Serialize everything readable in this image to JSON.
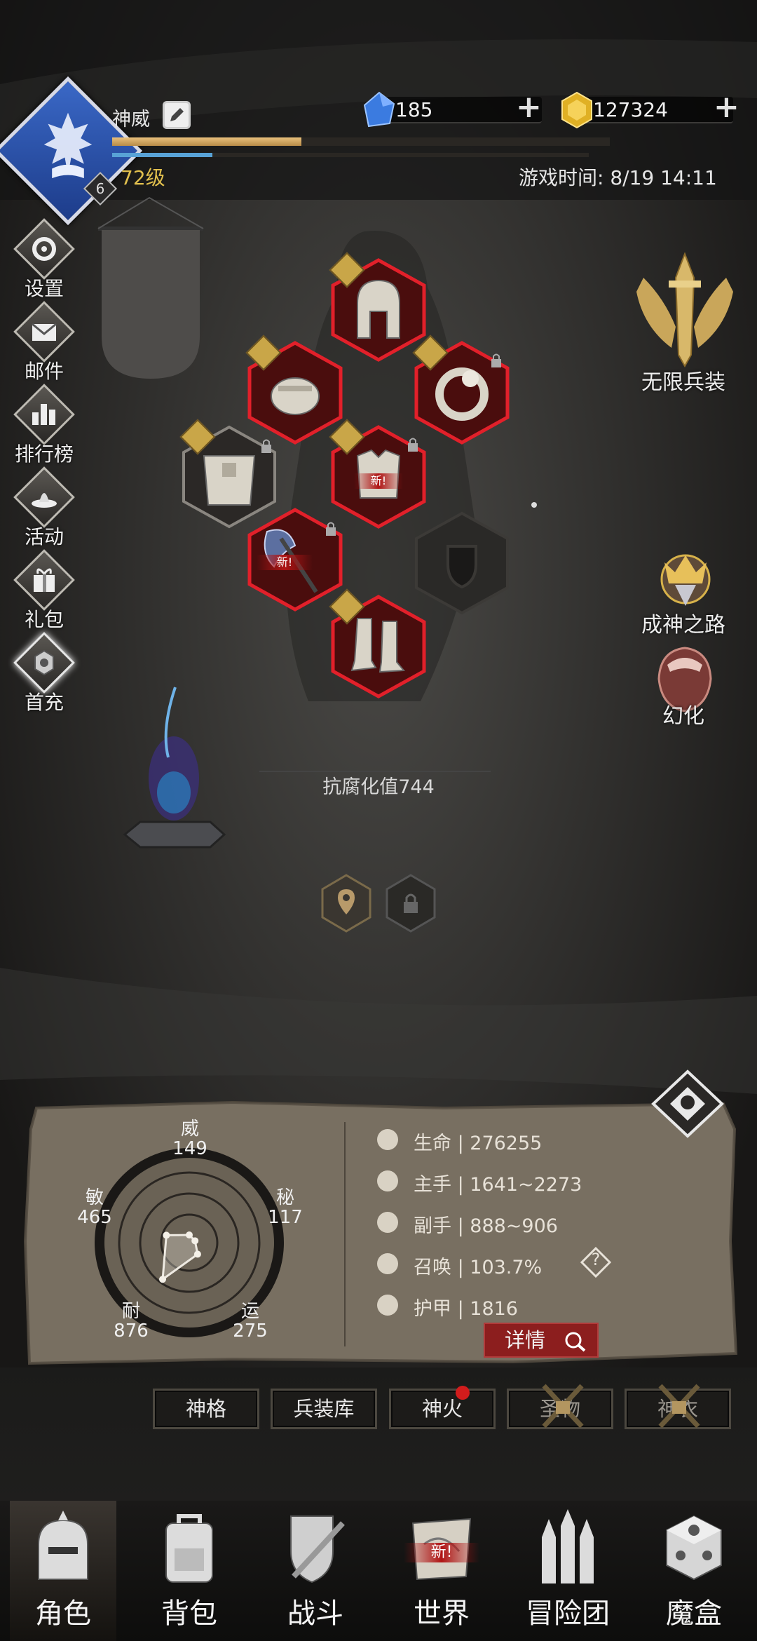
{
  "header": {
    "player_name": "神威",
    "level": "72级",
    "avatar_badge": "6",
    "xp_fraction": 0.38,
    "mp_fraction": 0.21,
    "game_time": "游戏时间: 8/19 14:11",
    "gems": "185",
    "gold": "127324"
  },
  "left_menu": [
    {
      "label": "设置",
      "icon": "gear-icon"
    },
    {
      "label": "邮件",
      "icon": "mail-icon"
    },
    {
      "label": "排行榜",
      "icon": "leaderboard-icon"
    },
    {
      "label": "活动",
      "icon": "event-icon"
    },
    {
      "label": "礼包",
      "icon": "gift-icon"
    },
    {
      "label": "首充",
      "icon": "first-recharge-icon"
    }
  ],
  "right_menu": {
    "infinite_arms": "无限兵装",
    "path_to_god": "成神之路",
    "transform": "幻化"
  },
  "equipment": {
    "new_badge": "新!",
    "slots": [
      "helmet",
      "bracer",
      "ring",
      "belt",
      "chest",
      "weapon",
      "shield",
      "boots"
    ]
  },
  "corruption_resistance": "抗腐化值744",
  "stats": {
    "radar": {
      "wei": {
        "label": "威",
        "value": "149"
      },
      "mi": {
        "label": "秘",
        "value": "117"
      },
      "yun": {
        "label": "运",
        "value": "275"
      },
      "nai": {
        "label": "耐",
        "value": "876"
      },
      "min": {
        "label": "敏",
        "value": "465"
      }
    },
    "rows": [
      {
        "label": "生命",
        "value": "276255",
        "icon": "heart-icon"
      },
      {
        "label": "主手",
        "value": "1641~2273",
        "icon": "sword-icon"
      },
      {
        "label": "副手",
        "value": "888~906",
        "icon": "dagger-icon"
      },
      {
        "label": "召唤",
        "value": "103.7%",
        "icon": "summon-icon"
      },
      {
        "label": "护甲",
        "value": "1816",
        "icon": "armor-icon"
      }
    ],
    "help": "?",
    "detail_button": "详情"
  },
  "sub_tabs": [
    "神格",
    "兵装库",
    "神火",
    "圣物",
    "神衣"
  ],
  "bottom_nav": [
    "角色",
    "背包",
    "战斗",
    "世界",
    "冒险团",
    "魔盒"
  ]
}
